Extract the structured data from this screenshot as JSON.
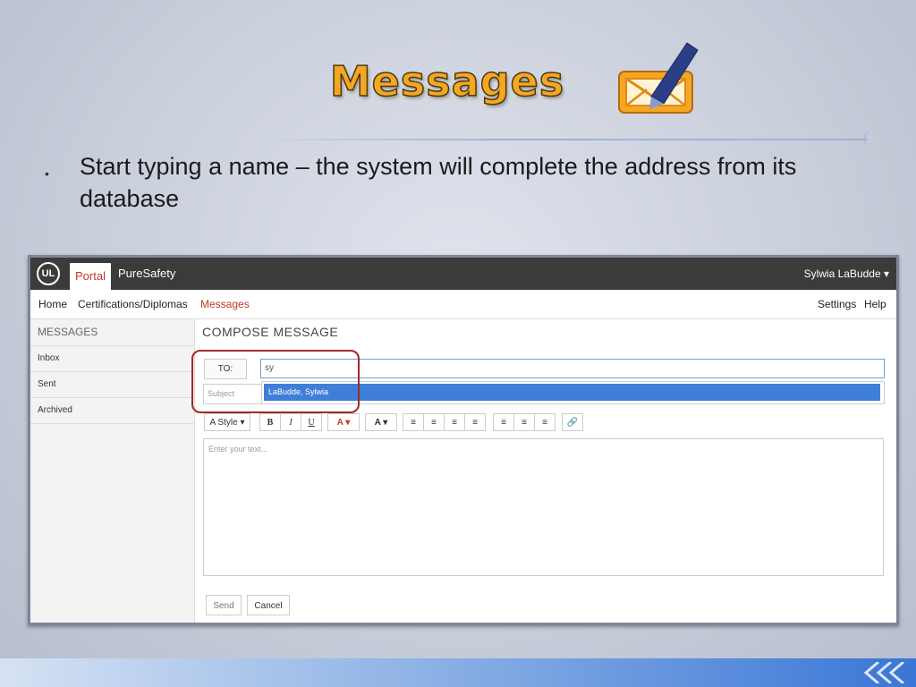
{
  "slide": {
    "title": "Messages",
    "bullet": "Start typing a name – the system will complete the address from its database",
    "icon": "envelope-pen-icon"
  },
  "app": {
    "topbar": {
      "logo": "UL",
      "tab_portal": "Portal",
      "brand": "PureSafety",
      "user": "Sylwia LaBudde ▾"
    },
    "nav": {
      "home": "Home",
      "certifications": "Certifications/Diplomas",
      "messages": "Messages",
      "settings": "Settings",
      "help": "Help"
    },
    "sidebar": {
      "header": "MESSAGES",
      "items": [
        "Inbox",
        "Sent",
        "Archived"
      ]
    },
    "compose": {
      "title": "COMPOSE MESSAGE",
      "to_label": "TO:",
      "to_value": "sy",
      "subject_placeholder": "Subject",
      "autocomplete": [
        "LaBudde, Sylwia"
      ],
      "editor_placeholder": "Enter your text...",
      "send": "Send",
      "cancel": "Cancel"
    },
    "toolbar": {
      "style": "A Style ▾",
      "bold": "B",
      "italic": "I",
      "underline": "U",
      "font_color": "A ▾",
      "highlight": "A ▾",
      "bullets": "≡",
      "numbered": "≡",
      "outdent": "≡",
      "indent": "≡",
      "align_left": "≡",
      "align_center": "≡",
      "align_right": "≡",
      "link": "🔗"
    }
  },
  "colors": {
    "accent_red": "#c0392b",
    "title_orange": "#f6a623",
    "autocomplete_blue": "#3f7fd8",
    "callout": "#a12a25"
  }
}
